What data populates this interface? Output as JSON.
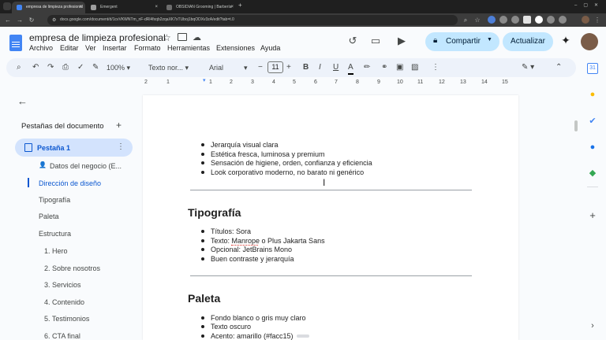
{
  "browser": {
    "tabs": [
      {
        "label": "empresa de limpieza profesional"
      },
      {
        "label": "Emergent"
      },
      {
        "label": "OBSIDIAN Grooming | Barbería"
      }
    ],
    "url": "docs.google.com/document/d/1cvVKWNTm_nF-dRl4fxqb2zqaXK7xTUboj1bqODXv3zA/edit?tab=t.0",
    "new_tab": "+"
  },
  "doc": {
    "title": "empresa de limpieza profesional",
    "menu": [
      "Archivo",
      "Editar",
      "Ver",
      "Insertar",
      "Formato",
      "Herramientas",
      "Extensiones",
      "Ayuda"
    ],
    "share_label": "Compartir",
    "update_label": "Actualizar"
  },
  "toolbar": {
    "zoom": "100%",
    "style": "Texto nor...",
    "font": "Arial",
    "size": "11",
    "bold": "B",
    "italic": "I",
    "underline": "U",
    "text_color": "A"
  },
  "ruler": [
    "2",
    "1",
    "1",
    "2",
    "3",
    "4",
    "5",
    "6",
    "7",
    "8",
    "9",
    "10",
    "11",
    "12",
    "13",
    "14",
    "15",
    "16",
    "17",
    "18"
  ],
  "outline": {
    "heading": "Pestañas del documento",
    "add": "+",
    "tab_name": "Pestaña 1",
    "items": [
      {
        "label": "Datos del negocio (E..."
      },
      {
        "label": "Dirección de diseño"
      },
      {
        "label": "Tipografía"
      },
      {
        "label": "Paleta"
      },
      {
        "label": "Estructura"
      },
      {
        "label": "1. Hero"
      },
      {
        "label": "2. Sobre nosotros"
      },
      {
        "label": "3. Servicios"
      },
      {
        "label": "4. Contenido"
      },
      {
        "label": "5. Testimonios"
      },
      {
        "label": "6. CTA final"
      }
    ]
  },
  "page": {
    "bullets_top": [
      "Jerarquía visual clara",
      "Estética fresca, luminosa y premium",
      "Sensación de higiene, orden, confianza y eficiencia",
      "Look corporativo moderno, no barato ni genérico"
    ],
    "h_typo": "Tipografía",
    "bullets_typo": [
      "Títulos: Sora",
      "Texto: Manrope o Plus Jakarta Sans",
      "Opcional: JetBrains Mono",
      "Buen contraste y jerarquía"
    ],
    "h_palette": "Paleta",
    "bullets_palette": [
      "Fondo blanco o gris muy claro",
      "Texto oscuro",
      "Acento: amarillo (#facc15)"
    ]
  },
  "colors": {
    "accent": "#c2e7ff",
    "selected": "#d3e3fd",
    "link": "#0b57d0",
    "swatch": "#facc15"
  }
}
